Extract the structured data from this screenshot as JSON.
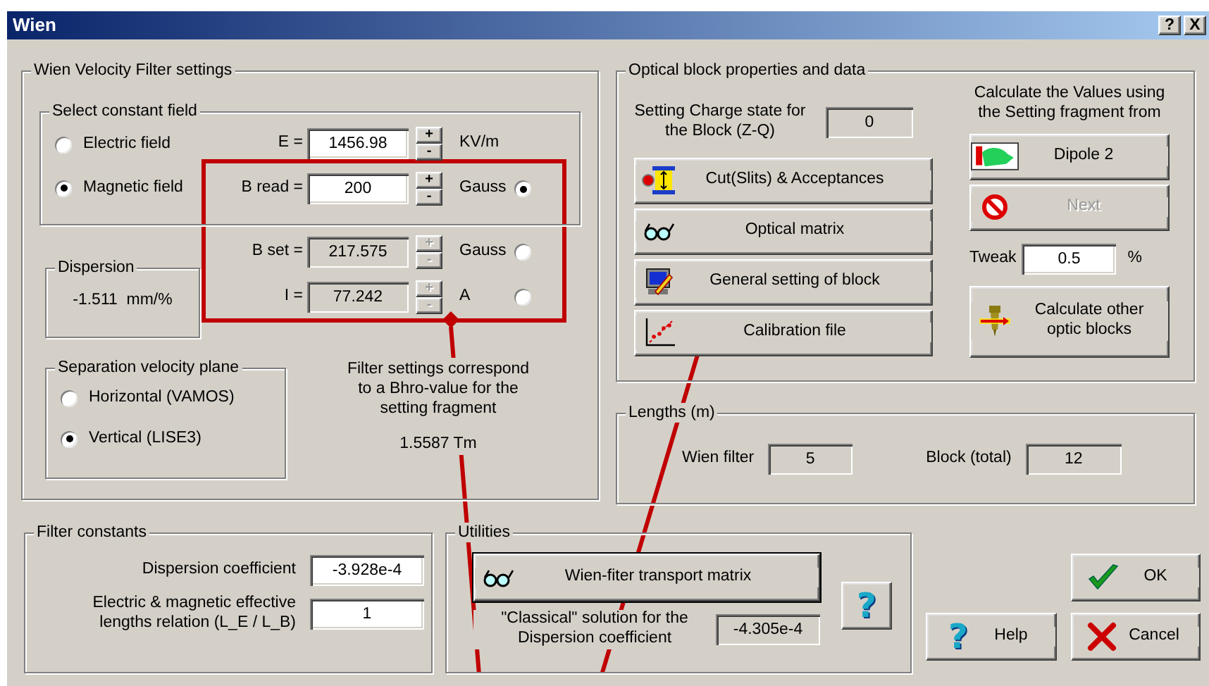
{
  "window": {
    "title": "Wien",
    "controls": [
      "?",
      "X"
    ]
  },
  "wien_settings": {
    "title": "Wien Velocity Filter settings",
    "constant_field": {
      "title": "Select constant field",
      "options": [
        {
          "label": "Electric field",
          "selected": false
        },
        {
          "label": "Magnetic field",
          "selected": true
        }
      ]
    },
    "fields": [
      {
        "label": "E =",
        "value": "1456.98",
        "unit": "KV/m",
        "disabled": false,
        "spin": [
          "+",
          "-"
        ]
      },
      {
        "label": "B read =",
        "value": "200",
        "unit": "Gauss",
        "disabled": false,
        "spin": [
          "+",
          "-"
        ],
        "selected": true
      },
      {
        "label": "B set =",
        "value": "217.575",
        "unit": "Gauss",
        "disabled": true,
        "spin": [
          "+",
          "-"
        ],
        "selected": false
      },
      {
        "label": "I =",
        "value": "77.242",
        "unit": "A",
        "disabled": true,
        "spin": [
          "+",
          "-"
        ],
        "selected": false
      }
    ],
    "dispersion": {
      "title": "Dispersion",
      "value": "-1.511  mm/%"
    },
    "separation_plane": {
      "title": "Separation velocity plane",
      "options": [
        {
          "label": "Horizontal (VAMOS)",
          "selected": false
        },
        {
          "label": "Vertical (LISE3)",
          "selected": true
        }
      ]
    },
    "bhro_note": "Filter settings correspond to a Bhro-value for the setting fragment",
    "bhro_value": "1.5587 Tm"
  },
  "optical_block": {
    "title": "Optical block properties and data",
    "charge_label": "Setting Charge state for the Block (Z-Q)",
    "charge_value": "0",
    "buttons": [
      {
        "kind": "cut",
        "label": "Cut(Slits) & Acceptances"
      },
      {
        "kind": "glasses",
        "label": "Optical matrix"
      },
      {
        "kind": "computer",
        "label": "General setting of block"
      },
      {
        "kind": "calibration",
        "label": "Calibration file"
      }
    ],
    "fragment_note": "Calculate the Values using the Setting fragment from",
    "fragment_buttons": [
      {
        "kind": "dipole",
        "label": "Dipole 2",
        "disabled": false
      },
      {
        "kind": "forbidden",
        "label": "Next",
        "disabled": true
      }
    ],
    "tweak": {
      "label": "Tweak",
      "value": "0.5",
      "unit": "%"
    },
    "calc_button": "Calculate other optic blocks"
  },
  "lengths": {
    "title": "Lengths (m)",
    "items": [
      {
        "label": "Wien filter",
        "value": "5"
      },
      {
        "label": "Block (total)",
        "value": "12"
      }
    ]
  },
  "filter_constants": {
    "title": "Filter constants",
    "rows": [
      {
        "label": "Dispersion coefficient",
        "value": "-3.928e-4"
      },
      {
        "label": "Electric & magnetic effective lengths relation (L_E / L_B)",
        "value": "1"
      }
    ]
  },
  "utilities": {
    "title": "Utilities",
    "matrix_button": "Wien-fiter transport matrix",
    "classical_label": "\"Classical\" solution for the Dispersion coefficient",
    "classical_value": "-4.305e-4",
    "help_glyph": "?"
  },
  "dialog_buttons": [
    {
      "kind": "ok",
      "label": "OK"
    },
    {
      "kind": "help",
      "glyph": "?",
      "label": "Help"
    },
    {
      "kind": "cancel",
      "label": "Cancel"
    }
  ]
}
